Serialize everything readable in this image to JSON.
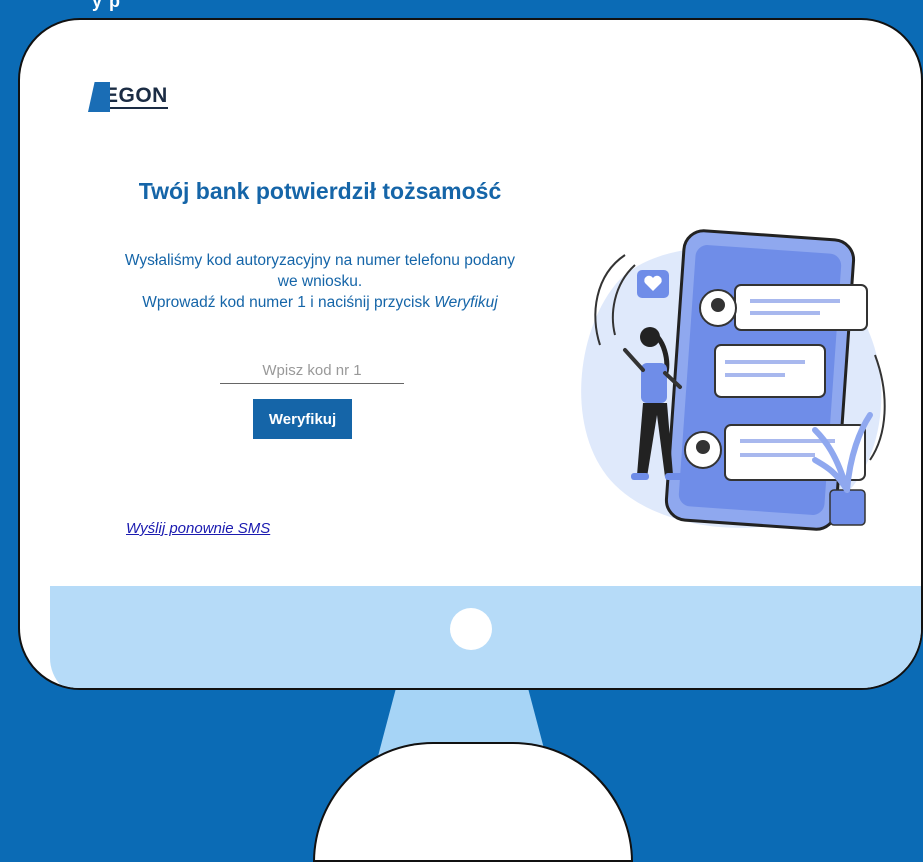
{
  "header": {
    "partial_text": "y  p"
  },
  "logo": {
    "text": "EGON",
    "alt": "AEGON"
  },
  "title": "Twój bank potwierdził tożsamość",
  "description": {
    "line1": "Wysłaliśmy kod autoryzacyjny na numer telefonu podany",
    "line2": "we wniosku.",
    "line3_prefix": "Wprowadź kod numer 1 i naciśnij przycisk ",
    "line3_emphasis": "Weryfikuj"
  },
  "code_input": {
    "placeholder": "Wpisz kod nr 1",
    "value": ""
  },
  "verify_button": {
    "label": "Weryfikuj"
  },
  "resend_link": {
    "label": "Wyślij ponownie SMS"
  },
  "illustration": {
    "name": "woman-with-phone-chat-illustration"
  },
  "colors": {
    "background": "#0b6bb5",
    "primary": "#1565a8",
    "chin": "#b6dbf8",
    "link": "#1b1bb0"
  }
}
